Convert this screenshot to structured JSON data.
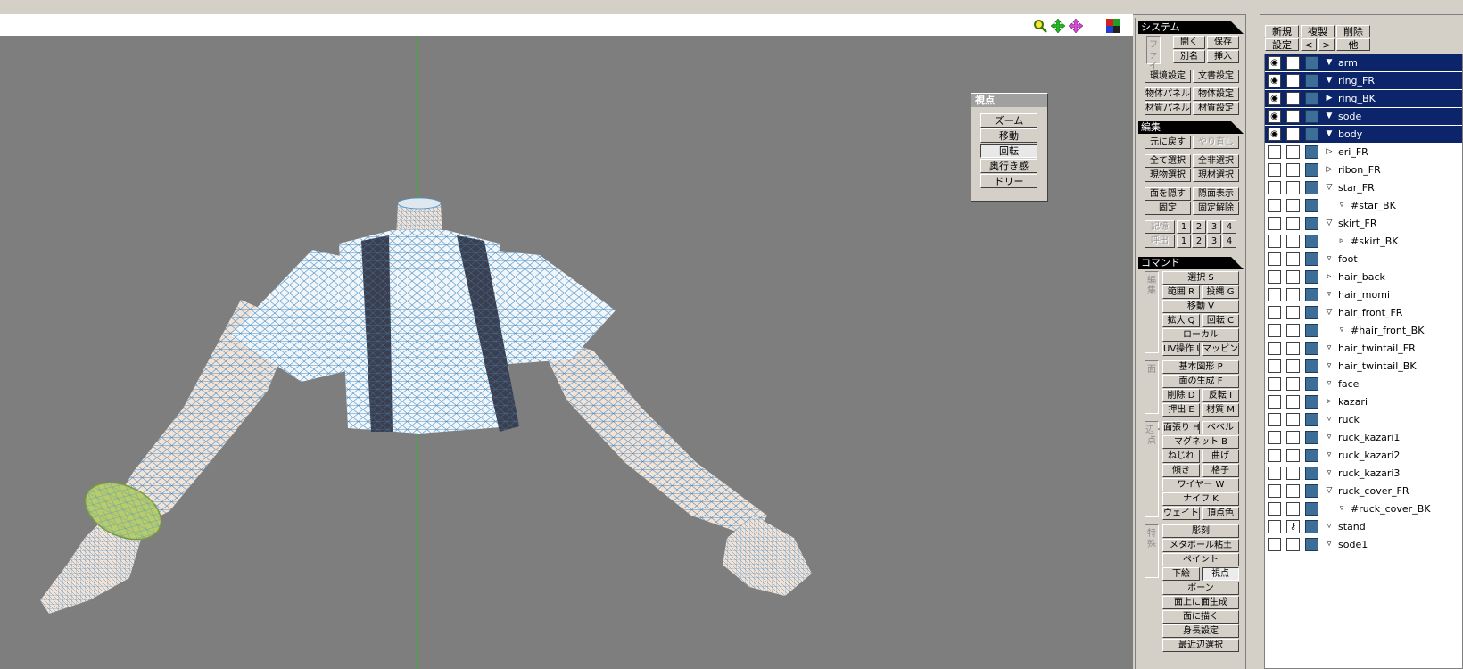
{
  "viewport": {
    "toolbar_icons": [
      "zoom-icon",
      "move-icon",
      "rotate-icon",
      "color-icon"
    ],
    "view_panel": {
      "title": "視点",
      "buttons": [
        {
          "label": "ズーム",
          "selected": false
        },
        {
          "label": "移動",
          "selected": false
        },
        {
          "label": "回転",
          "selected": true
        },
        {
          "label": "奥行き感",
          "selected": false
        },
        {
          "label": "ドリー",
          "selected": false
        }
      ]
    }
  },
  "command_panel": {
    "system_title": "システム",
    "file_label": "ファイル",
    "open": "開く",
    "save": "保存",
    "save_as": "別名",
    "insert": "挿入",
    "env_settings": "環境設定",
    "doc_settings": "文書設定",
    "object_panel": "物体パネル",
    "object_settings": "物体設定",
    "material_panel": "材質パネル",
    "material_settings": "材質設定",
    "edit_title": "編集",
    "undo": "元に戻す",
    "redo": "やり直し",
    "select_all": "全て選択",
    "deselect_all": "全非選択",
    "select_current_object": "現物選択",
    "select_current_material": "現材選択",
    "hide_faces": "面を隠す",
    "show_hidden": "隠面表示",
    "fix": "固定",
    "unfix": "固定解除",
    "memory": "記憶",
    "recall": "呼出",
    "slots": [
      "1",
      "2",
      "3",
      "4"
    ],
    "command_title": "コマンド",
    "edit_label": "編集",
    "face_label": "面",
    "edge_vertex_label": "辺・点",
    "special_label": "特殊",
    "cmd_select": "選択 S",
    "cmd_range": "範囲 R",
    "cmd_lasso": "投縄 G",
    "cmd_move": "移動 V",
    "cmd_scale": "拡大 Q",
    "cmd_rotate": "回転 C",
    "cmd_local": "ローカル",
    "cmd_uv": "UV操作 U",
    "cmd_mapping": "マッピング",
    "cmd_primitive": "基本図形 P",
    "cmd_face_gen": "面の生成 F",
    "cmd_delete": "削除 D",
    "cmd_flip": "反転 I",
    "cmd_extrude": "押出 E",
    "cmd_material": "材質 M",
    "cmd_stretch": "面張り H",
    "cmd_bevel": "ベベル",
    "cmd_magnet": "マグネット B",
    "cmd_twist": "ねじれ",
    "cmd_bend": "曲げ",
    "cmd_tilt": "傾き",
    "cmd_lattice": "格子",
    "cmd_wire": "ワイヤー W",
    "cmd_knife": "ナイフ K",
    "cmd_weight": "ウェイト",
    "cmd_vertex_color": "頂点色",
    "cmd_sculpt": "彫刻",
    "cmd_metaball": "メタボール粘土",
    "cmd_paint": "ペイント",
    "cmd_underlay": "下絵",
    "cmd_viewpoint": "視点",
    "cmd_bone": "ボーン",
    "cmd_face_on_face": "面上に面生成",
    "cmd_draw_on_face": "面に描く",
    "cmd_height": "身長設定",
    "cmd_nearby": "最近辺選択"
  },
  "object_panel": {
    "new": "新規",
    "duplicate": "複製",
    "delete": "削除",
    "settings": "設定",
    "prev": "<",
    "next": ">",
    "other": "他",
    "objects": [
      {
        "name": "arm",
        "depth": 0,
        "expand": "open",
        "visible": true,
        "selected": true
      },
      {
        "name": "ring_FR",
        "depth": 0,
        "expand": "open",
        "visible": true,
        "selected": true
      },
      {
        "name": "ring_BK",
        "depth": 0,
        "expand": "closed",
        "visible": true,
        "selected": true
      },
      {
        "name": "sode",
        "depth": 0,
        "expand": "open",
        "visible": true,
        "selected": true
      },
      {
        "name": "body",
        "depth": 0,
        "expand": "open",
        "visible": true,
        "selected": true
      },
      {
        "name": "eri_FR",
        "depth": 0,
        "expand": "closed-outline",
        "visible": false,
        "selected": false
      },
      {
        "name": "ribon_FR",
        "depth": 0,
        "expand": "closed-outline",
        "visible": false,
        "selected": false
      },
      {
        "name": "star_FR",
        "depth": 0,
        "expand": "open-outline",
        "visible": false,
        "selected": false
      },
      {
        "name": "#star_BK",
        "depth": 1,
        "expand": "small",
        "visible": false,
        "selected": false
      },
      {
        "name": "skirt_FR",
        "depth": 0,
        "expand": "open-outline",
        "visible": false,
        "selected": false
      },
      {
        "name": "#skirt_BK",
        "depth": 1,
        "expand": "small-closed",
        "visible": false,
        "selected": false
      },
      {
        "name": "foot",
        "depth": 0,
        "expand": "small",
        "visible": false,
        "selected": false
      },
      {
        "name": "hair_back",
        "depth": 0,
        "expand": "small-closed",
        "visible": false,
        "selected": false
      },
      {
        "name": "hair_momi",
        "depth": 0,
        "expand": "small",
        "visible": false,
        "selected": false
      },
      {
        "name": "hair_front_FR",
        "depth": 0,
        "expand": "open-outline",
        "visible": false,
        "selected": false
      },
      {
        "name": "#hair_front_BK",
        "depth": 1,
        "expand": "small",
        "visible": false,
        "selected": false
      },
      {
        "name": "hair_twintail_FR",
        "depth": 0,
        "expand": "small",
        "visible": false,
        "selected": false
      },
      {
        "name": "hair_twintail_BK",
        "depth": 0,
        "expand": "small",
        "visible": false,
        "selected": false
      },
      {
        "name": "face",
        "depth": 0,
        "expand": "small",
        "visible": false,
        "selected": false
      },
      {
        "name": "kazari",
        "depth": 0,
        "expand": "small-closed",
        "visible": false,
        "selected": false
      },
      {
        "name": "ruck",
        "depth": 0,
        "expand": "small",
        "visible": false,
        "selected": false
      },
      {
        "name": "ruck_kazari1",
        "depth": 0,
        "expand": "small",
        "visible": false,
        "selected": false
      },
      {
        "name": "ruck_kazari2",
        "depth": 0,
        "expand": "small",
        "visible": false,
        "selected": false
      },
      {
        "name": "ruck_kazari3",
        "depth": 0,
        "expand": "small",
        "visible": false,
        "selected": false
      },
      {
        "name": "ruck_cover_FR",
        "depth": 0,
        "expand": "open-outline",
        "visible": false,
        "selected": false
      },
      {
        "name": "#ruck_cover_BK",
        "depth": 1,
        "expand": "small",
        "visible": false,
        "selected": false
      },
      {
        "name": "stand",
        "depth": 0,
        "expand": "small",
        "visible": false,
        "locked": true,
        "selected": false
      },
      {
        "name": "sode1",
        "depth": 0,
        "expand": "small",
        "visible": false,
        "selected": false
      }
    ]
  }
}
